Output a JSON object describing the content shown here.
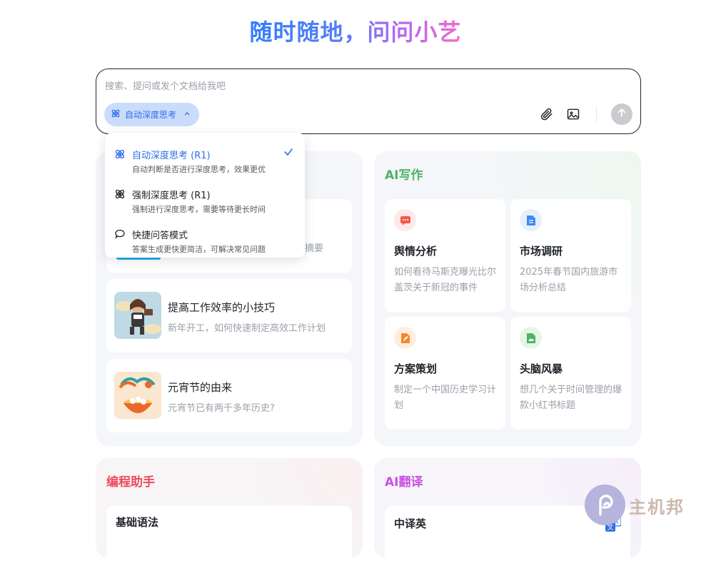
{
  "hero": {
    "title": "随时随地，问问小艺"
  },
  "input": {
    "placeholder": "搜索、提问或发个文档给我吧",
    "mode_label": "自动深度思考",
    "icons": [
      "atom-icon",
      "chevron-up-icon",
      "paperclip-icon",
      "image-icon",
      "arrow-up-icon"
    ]
  },
  "dropdown": {
    "items": [
      {
        "label": "自动深度思考 (R1)",
        "desc": "自动判断是否进行深度思考，效果更优",
        "icon": "atom-icon",
        "selected": true
      },
      {
        "label": "强制深度思考 (R1)",
        "desc": "强制进行深度思考，需要等待更长时间",
        "icon": "atom-icon",
        "selected": false
      },
      {
        "label": "快捷问答模式",
        "desc": "答案生成更快更简洁，可解决常见问题",
        "icon": "chat-bubble-icon",
        "selected": false
      }
    ]
  },
  "left_top": {
    "items": [
      {
        "title": "",
        "subtitle": "摘要"
      },
      {
        "title": "提高工作效率的小技巧",
        "subtitle": "新年开工，如何快速制定高效工作计划"
      },
      {
        "title": "元宵节的由来",
        "subtitle": "元宵节已有两千多年历史?"
      }
    ]
  },
  "writing": {
    "title": "AI写作",
    "title_color": "#4cb561",
    "tiles": [
      {
        "title": "舆情分析",
        "subtitle": "如何看待马斯克曝光比尔盖茨关于新冠的事件",
        "icon": "chat-alert-icon",
        "color": "#f2594b"
      },
      {
        "title": "市场调研",
        "subtitle": "2025年春节国内旅游市场分析总结",
        "icon": "document-icon",
        "color": "#3b8cf5"
      },
      {
        "title": "方案策划",
        "subtitle": "制定一个中国历史学习计划",
        "icon": "edit-doc-icon",
        "color": "#f28a2c"
      },
      {
        "title": "头脑风暴",
        "subtitle": "想几个关于时间管理的爆款小红书标题",
        "icon": "image-doc-icon",
        "color": "#4cb561"
      }
    ]
  },
  "coding": {
    "title": "编程助手",
    "title_color": "#f0485a",
    "item": "基础语法"
  },
  "translate": {
    "title": "AI翻译",
    "title_color": "#c851e0",
    "item": "中译英"
  },
  "watermark": {
    "text": "主机邦"
  }
}
